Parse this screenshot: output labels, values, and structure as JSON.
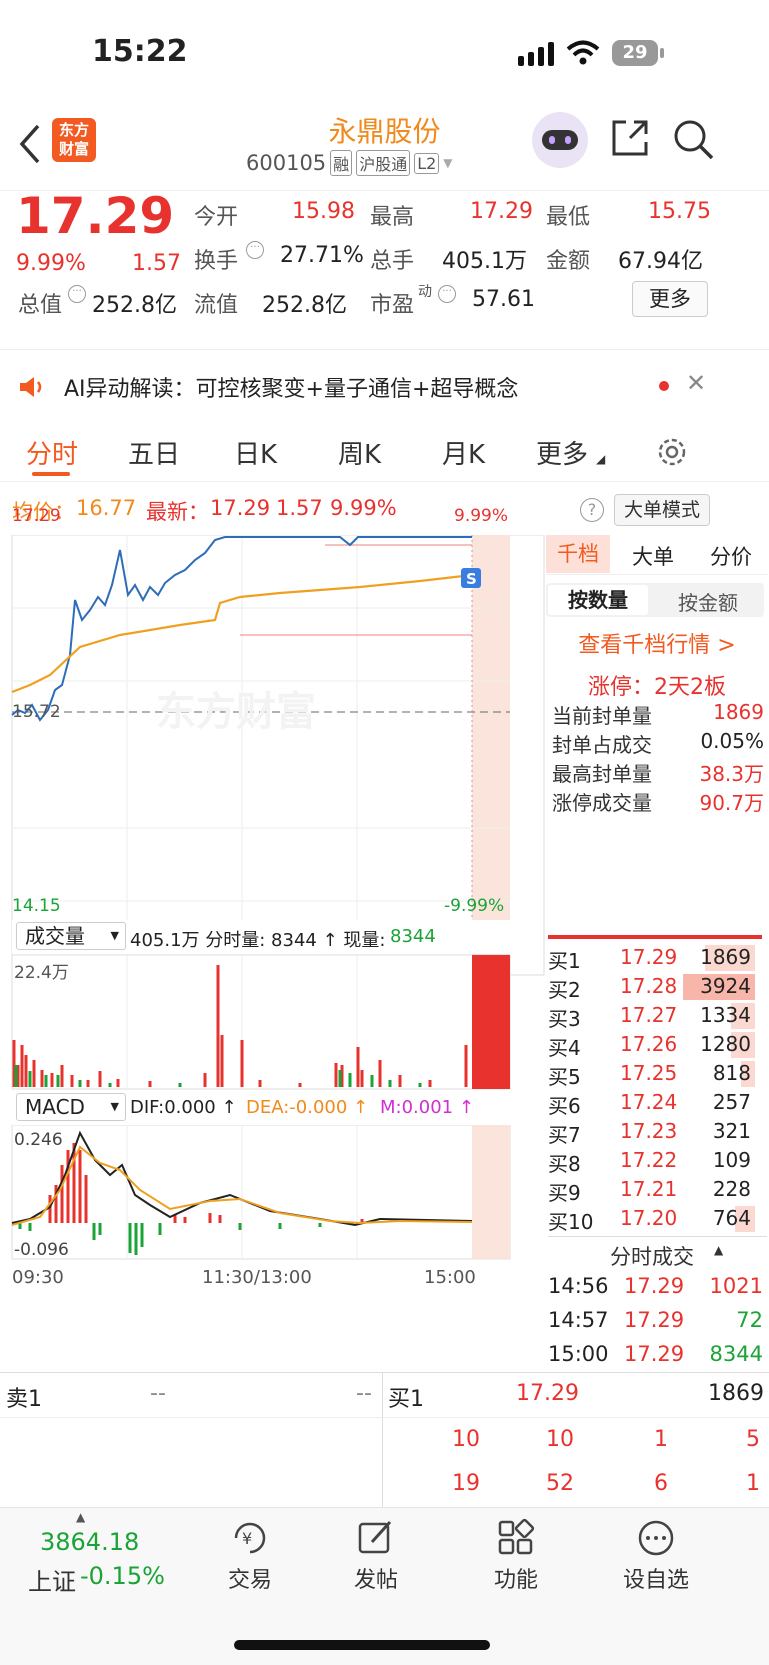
{
  "status": {
    "time": "15:22",
    "battery": "29"
  },
  "header": {
    "logo": [
      "东方",
      "财富"
    ],
    "name": "永鼎股份",
    "code": "600105",
    "tags": [
      "融",
      "沪股通",
      "L2"
    ]
  },
  "quote": {
    "price": "17.29",
    "pct": "9.99%",
    "chg": "1.57",
    "open_label": "今开",
    "open": "15.98",
    "high_label": "最高",
    "high": "17.29",
    "low_label": "最低",
    "low": "15.75",
    "turnover_label": "换手",
    "turnover": "27.71%",
    "volume_label": "总手",
    "volume": "405.1万",
    "amount_label": "金额",
    "amount": "67.94亿",
    "mcap_label": "总值",
    "mcap": "252.8亿",
    "float_label": "流值",
    "float": "252.8亿",
    "pe_label": "市盈",
    "pe_sup": "动",
    "pe": "57.61",
    "more": "更多"
  },
  "ai": {
    "text": "AI异动解读：可控核聚变+量子通信+超导概念"
  },
  "tabs": [
    "分时",
    "五日",
    "日K",
    "周K",
    "月K",
    "更多"
  ],
  "avg": {
    "avg_label": "均价：",
    "avg": "16.77",
    "latest_label": "最新：",
    "latest": "17.29",
    "chg": "1.57",
    "pct": "9.99%",
    "mode": "大单模式"
  },
  "chart_labels": {
    "top": "17.29",
    "top_pct": "9.99%",
    "mid": "15.72",
    "bottom": "14.15",
    "bottom_pct": "-9.99%",
    "vol_max": "22.4万",
    "macd_hi": "0.246",
    "macd_lo": "-0.096",
    "t0": "09:30",
    "t1": "11:30/13:00",
    "t2": "15:00",
    "watermark": "东方财富"
  },
  "vol_bar": {
    "label": "成交量",
    "info": "405.1万 分时量: 8344 ↑ 现量:",
    "now": "8344"
  },
  "macd_bar": {
    "label": "MACD",
    "dif": "DIF:0.000 ↑",
    "dea": "DEA:-0.000 ↑",
    "m": "M:0.001 ↑"
  },
  "side": {
    "tabs": [
      "千档",
      "大单",
      "分价"
    ],
    "sub": [
      "按数量",
      "按金额"
    ],
    "link": "查看千档行情 >",
    "limit": "涨停：2天2板",
    "stats": [
      [
        "当前封单量",
        "1869"
      ],
      [
        "封单占成交",
        "0.05%"
      ],
      [
        "最高封单量",
        "38.3万"
      ],
      [
        "涨停成交量",
        "90.7万"
      ]
    ]
  },
  "book": [
    [
      "买1",
      "17.29",
      "1869"
    ],
    [
      "买2",
      "17.28",
      "3924"
    ],
    [
      "买3",
      "17.27",
      "1334"
    ],
    [
      "买4",
      "17.26",
      "1280"
    ],
    [
      "买5",
      "17.25",
      "818"
    ],
    [
      "买6",
      "17.24",
      "257"
    ],
    [
      "买7",
      "17.23",
      "321"
    ],
    [
      "买8",
      "17.22",
      "109"
    ],
    [
      "买9",
      "17.21",
      "228"
    ],
    [
      "买10",
      "17.20",
      "764"
    ]
  ],
  "ticks_title": "分时成交",
  "ticks": [
    [
      "14:56",
      "17.29",
      "1021"
    ],
    [
      "14:57",
      "17.29",
      "72"
    ],
    [
      "15:00",
      "17.29",
      "8344"
    ]
  ],
  "bottom": {
    "sell_label": "卖1",
    "sell_a": "--",
    "sell_b": "--",
    "buy_label": "买1",
    "buy_price": "17.29",
    "buy_vol": "1869",
    "row1": [
      "10",
      "10",
      "1",
      "5"
    ],
    "row2": [
      "19",
      "52",
      "6",
      "1"
    ]
  },
  "nav": {
    "index": "3864.18",
    "index_name": "上证",
    "index_pct": "-0.15%",
    "items": [
      "交易",
      "发帖",
      "功能",
      "设自选"
    ]
  },
  "colors": {
    "up": "#e8322e",
    "down": "#1aa336",
    "accent": "#f08a1c"
  }
}
